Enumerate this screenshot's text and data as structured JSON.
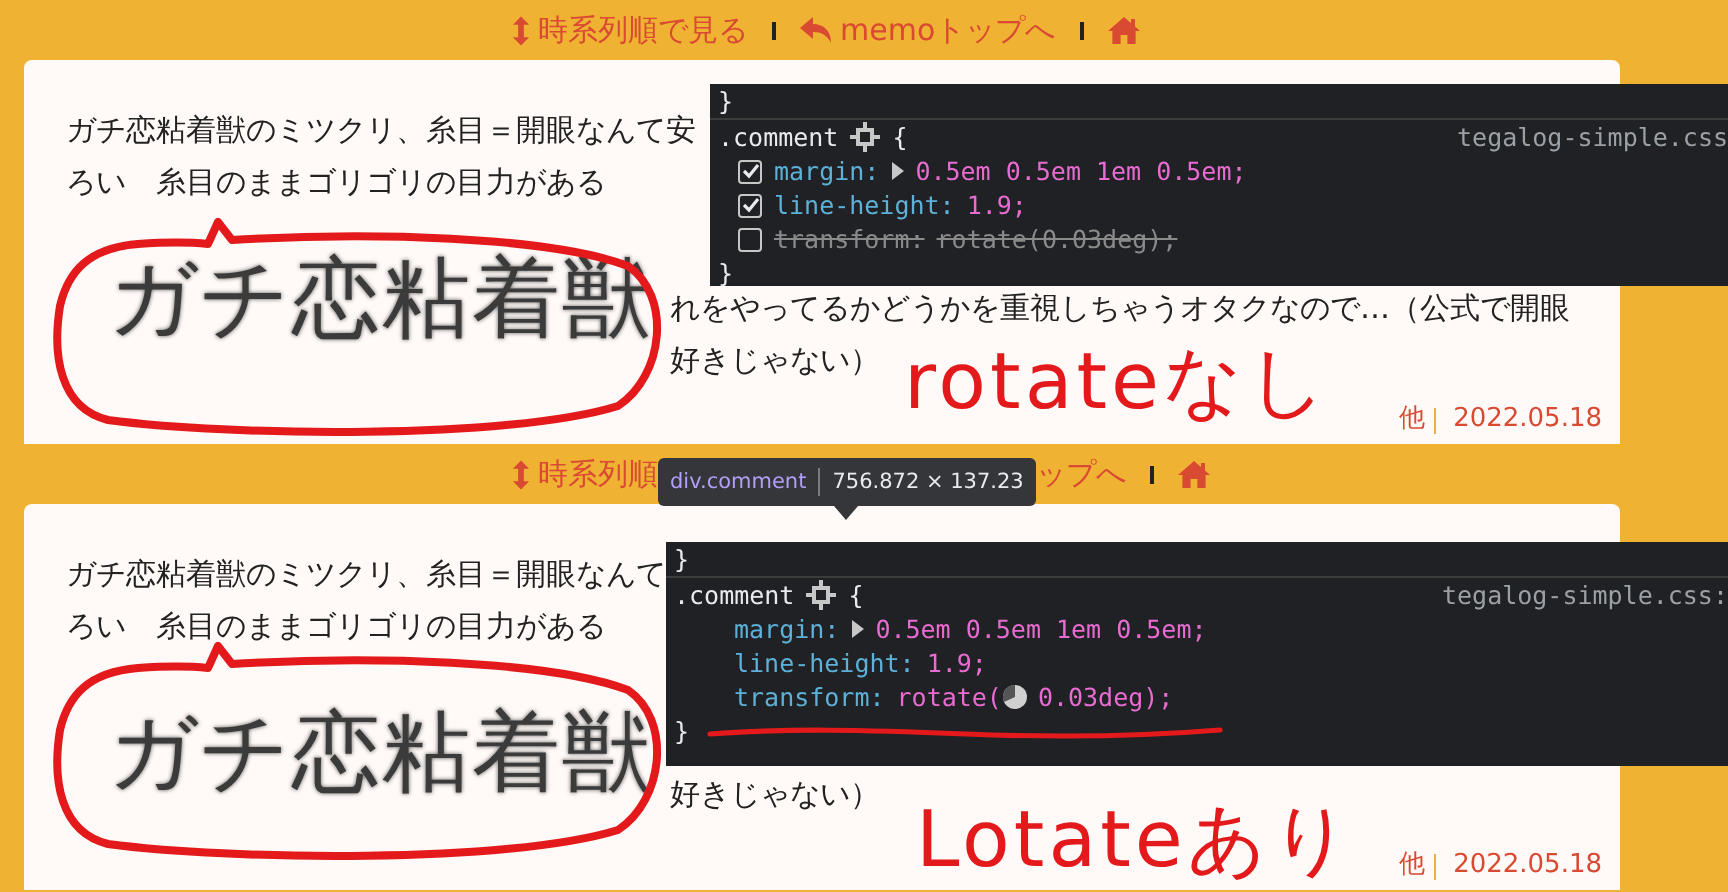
{
  "panels": [
    {
      "nav": [
        {
          "kind": "timeline_link",
          "label": "時系列順で見る"
        },
        {
          "kind": "back_link",
          "label": "memoトップへ"
        },
        {
          "kind": "home"
        }
      ],
      "lines": [
        "ガチ恋粘着獣のミツクリ、糸目＝開眼なんて安",
        "ろい　糸目のままゴリゴリの目力がある"
      ],
      "lines_after": [
        "れをやってるかどうかを重視しちゃうオタクなので…（公式で開眼",
        "好きじゃない）"
      ],
      "magnified_text": "ガチ恋粘着獣",
      "devtools": {
        "before": "}",
        "selector": ".comment",
        "open": "{",
        "file": "tegalog-simple.css",
        "declarations": [
          {
            "property": "margin:",
            "expandable": true,
            "value": [
              "0.5em 0.5em 1em 0.5em;"
            ],
            "checked": true
          },
          {
            "property": "line-height:",
            "value": [
              "1.9;"
            ],
            "checked": true
          },
          {
            "property": "transform:",
            "value": [
              "rotate(0.03deg);"
            ],
            "checked": false
          }
        ],
        "after": "}"
      },
      "annotation": "rotateなし",
      "footer": {
        "author": "他",
        "date": "2022.05.18"
      }
    },
    {
      "nav": [
        {
          "kind": "timeline_link",
          "label": "時系列順"
        },
        {
          "kind": "tooltip",
          "element": "div.comment",
          "size": "756.872 × 137.23"
        },
        {
          "kind": "link",
          "label": "ップへ"
        },
        {
          "kind": "home"
        }
      ],
      "lines": [
        "ガチ恋粘着獣のミツクリ、糸目＝開眼なんて",
        "ろい　糸目のままゴリゴリの目力がある"
      ],
      "lines_after": [
        "好きじゃない）"
      ],
      "magnified_text": "ガチ恋粘着獣",
      "devtools": {
        "before": "}",
        "selector": ".comment",
        "open": "{",
        "file": "tegalog-simple.css:",
        "declarations": [
          {
            "property": "margin:",
            "expandable": true,
            "value": [
              "0.5em 0.5em 1em 0.5em;"
            ]
          },
          {
            "property": "line-height:",
            "value": [
              "1.9;"
            ]
          },
          {
            "property": "transform:",
            "value": [
              "rotate(",
              "0.03deg);"
            ],
            "angle_icon": true,
            "highlighted": true
          }
        ],
        "after": "}"
      },
      "annotation": "Lotateあり",
      "footer": {
        "author": "他",
        "date": "2022.05.18"
      }
    }
  ]
}
